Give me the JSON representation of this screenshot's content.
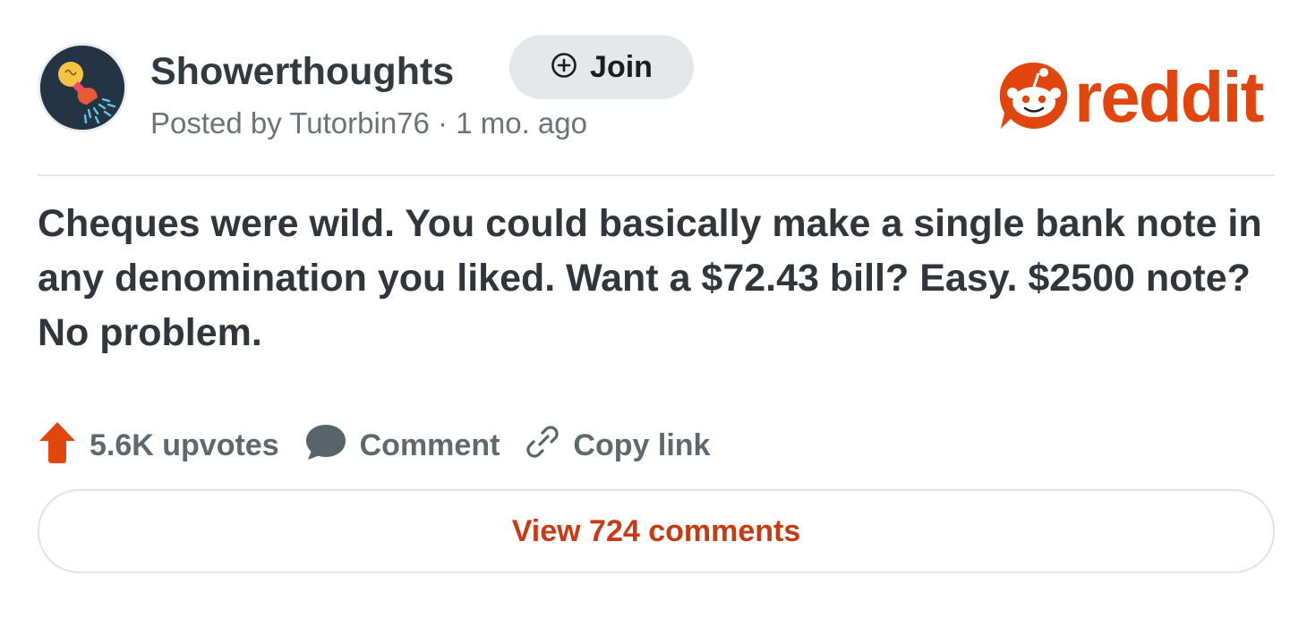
{
  "subreddit": {
    "name": "Showerthoughts",
    "join_label": "Join"
  },
  "post": {
    "meta": "Posted by Tutorbin76 · 1 mo. ago",
    "title": "Cheques were wild. You could basically make a single bank note in any denomination you liked. Want a $72.43 bill? Easy. $2500 note? No problem."
  },
  "brand": {
    "logo_text": "reddit",
    "accent_color": "#e2460f"
  },
  "actions": {
    "upvotes_label": "5.6K upvotes",
    "comment_label": "Comment",
    "copy_link_label": "Copy link"
  },
  "footer": {
    "view_comments_label": "View 724 comments"
  },
  "icons": {
    "avatar": "lightbulb-shower-icon",
    "join": "plus-circle-icon",
    "logo": "reddit-snoo-icon",
    "upvote": "upvote-arrow-icon",
    "comment": "speech-bubble-icon",
    "copy": "link-icon"
  }
}
